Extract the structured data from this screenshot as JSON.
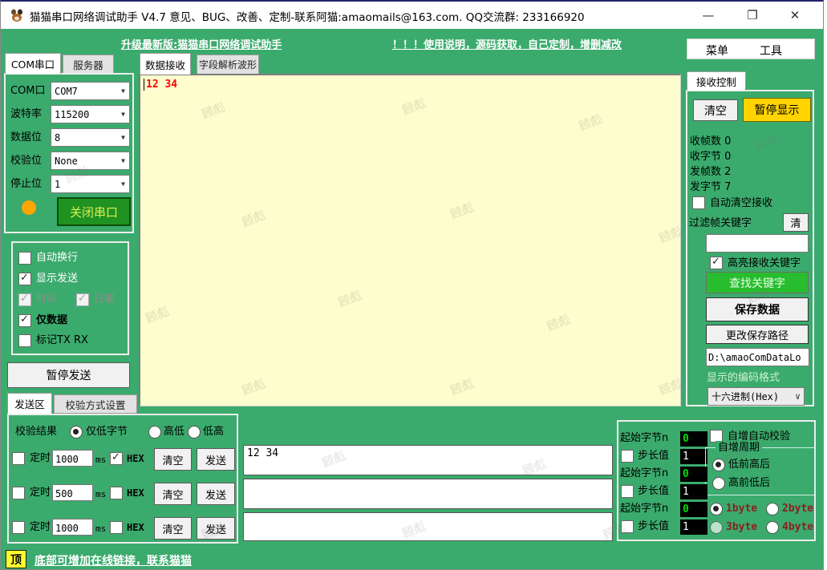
{
  "titlebar": {
    "title": "猫猫串口网络调试助手 V4.7 意见、BUG、改善、定制-联系阿猫:amaomails@163.com. QQ交流群: 233166920",
    "controls": {
      "minimize": "—",
      "maximize": "❐",
      "close": "✕"
    }
  },
  "header": {
    "upgrade_link": "升级最新版:猫猫串口网络调试助手",
    "help_link": "！！！使用说明，源码获取，自己定制，增删减改",
    "menu": {
      "menu_label": "菜单",
      "tools_label": "工具"
    }
  },
  "com_panel": {
    "tab_com": "COM串口",
    "tab_server": "服务器",
    "fields": [
      {
        "label": "COM口",
        "value": "COM7"
      },
      {
        "label": "波特率",
        "value": "115200"
      },
      {
        "label": "数据位",
        "value": "8"
      },
      {
        "label": "校验位",
        "value": "None"
      },
      {
        "label": "停止位",
        "value": "1"
      }
    ],
    "close_button": "关闭串口",
    "options": {
      "auto_newline": {
        "label": "自动换行",
        "checked": false
      },
      "show_send": {
        "label": "显示发送",
        "checked": true
      },
      "time": {
        "label": "时间",
        "checked": true,
        "disabled": true
      },
      "date": {
        "label": "日期",
        "checked": true,
        "disabled": true
      },
      "data_only": {
        "label": "仅数据",
        "checked": true
      },
      "mark_txrx": {
        "label": "标记TX RX",
        "checked": false
      }
    },
    "pause_send_button": "暂停发送",
    "send_tab": "发送区",
    "checksum_tab": "校验方式设置"
  },
  "main": {
    "tab_receive": "数据接收",
    "tab_waveform": "字段解析波形",
    "receive_text": "12 34"
  },
  "receive_control": {
    "tab": "接收控制",
    "clear_button": "清空",
    "pause_display_button": "暂停显示",
    "stats": [
      {
        "label": "收帧数",
        "value": "0"
      },
      {
        "label": "收字节",
        "value": "0"
      },
      {
        "label": "发帧数",
        "value": "2"
      },
      {
        "label": "发字节",
        "value": "7"
      }
    ],
    "auto_clear": {
      "label": "自动清空接收",
      "checked": false
    },
    "filter_label": "过滤帧关键字",
    "filter_clear_button": "清",
    "filter_input_value": "",
    "highlight": {
      "label": "高亮接收关键字",
      "checked": true
    },
    "find_keyword_button": "查找关键字",
    "save_data_button": "保存数据",
    "change_path_button": "更改保存路径",
    "save_path_value": "D:\\amaoComDataLo",
    "encoding_label": "显示的编码格式",
    "encoding_value": "十六进制(Hex)"
  },
  "send_panel": {
    "checksum_label": "校验结果",
    "checksum_options": [
      {
        "label": "仅低字节",
        "selected": true
      },
      {
        "label": "高低",
        "selected": false
      },
      {
        "label": "低高",
        "selected": false
      }
    ],
    "timer_label": "定时",
    "ms_label": "ms",
    "hex_label": "HEX",
    "clear_button": "清空",
    "send_button": "发送",
    "rows": [
      {
        "interval": "1000",
        "timer_checked": false,
        "hex_checked": true,
        "input_value": "12 34"
      },
      {
        "interval": "500",
        "timer_checked": false,
        "hex_checked": false,
        "input_value": ""
      },
      {
        "interval": "1000",
        "timer_checked": false,
        "hex_checked": false,
        "input_value": ""
      }
    ],
    "increment": {
      "start_label": "起始字节n",
      "step_label": "步长值",
      "rows": [
        {
          "start": "0",
          "step": "1",
          "step_checked": false
        },
        {
          "start": "0",
          "step": "1",
          "step_checked": false
        },
        {
          "start": "0",
          "step": "1",
          "step_checked": false
        }
      ],
      "auto_check_label": "自增自动校验",
      "auto_check_checked": false,
      "cycle_label": "自增周期",
      "cycle_options": [
        {
          "label": "低前高后",
          "selected": true
        },
        {
          "label": "高前低后",
          "selected": false
        }
      ],
      "byte_options": [
        {
          "label": "1byte",
          "selected": true
        },
        {
          "label": "2byte",
          "selected": false
        },
        {
          "label": "3byte",
          "selected": false
        },
        {
          "label": "4byte",
          "selected": false
        }
      ]
    }
  },
  "footer": {
    "top_button": "顶",
    "link": "底部可增加在线链接，联系猫猫"
  },
  "watermark": {
    "text": "顾彪"
  },
  "colors": {
    "window_green": "#3BAB6D",
    "receive_bg": "#FDFDCE",
    "pause_display_yellow": "#FFD400",
    "find_keyword_green": "#28BD2E",
    "close_serial_green": "#1F9222",
    "receive_text_red": "#FF0000",
    "byte_label_maroon": "#8B2020",
    "indicator_orange": "#FFA500",
    "top_button_yellow": "#FFFF2E"
  }
}
